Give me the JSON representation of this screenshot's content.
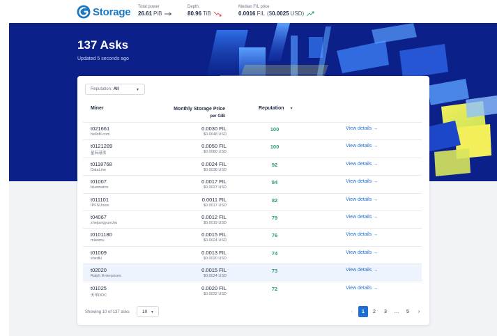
{
  "header": {
    "brand": "Storage",
    "brand_color": "#1a78c2",
    "stats": [
      {
        "label": "Total power",
        "value": "26.61",
        "unit": "PiB",
        "trend": "flat"
      },
      {
        "label": "Depth",
        "value": "80.96",
        "unit": "TiB",
        "trend": "down"
      },
      {
        "label": "Median FIL price",
        "value": "0.0016",
        "unit": "FIL",
        "extra_prefix": "($",
        "extra_value": "0.0025",
        "extra_suffix": "USD)",
        "trend": "up"
      }
    ]
  },
  "hero": {
    "title": "137 Asks",
    "subtitle": "Updated 5 seconds ago",
    "background_color": "#0b2189"
  },
  "filter": {
    "label": "Reputation:",
    "value": "All"
  },
  "table": {
    "columns": {
      "miner": "Miner",
      "price": "Monthly Storage Price",
      "price_sub": "per GiB",
      "reputation": "Reputation"
    },
    "rows": [
      {
        "id": "t021661",
        "name": "hellofil.com",
        "fil": "0.0030 FIL",
        "usd": "$0.0048 USD",
        "rep": "100",
        "link": "View details →"
      },
      {
        "id": "t0121289",
        "name": "星际港湾",
        "fil": "0.0050 FIL",
        "usd": "$0.0080 USD",
        "rep": "100",
        "link": "View details →"
      },
      {
        "id": "t0118768",
        "name": "DataLine",
        "fil": "0.0024 FIL",
        "usd": "$0.0038 USD",
        "rep": "92",
        "link": "View details →"
      },
      {
        "id": "t01007",
        "name": "bluematrix",
        "fil": "0.0017 FIL",
        "usd": "$0.0027 USD",
        "rep": "84",
        "link": "View details →"
      },
      {
        "id": "t011101",
        "name": "IPFSUnion",
        "fil": "0.0011 FIL",
        "usd": "$0.0017 USD",
        "rep": "82",
        "link": "View details →"
      },
      {
        "id": "t04067",
        "name": "zhejiangyunchu",
        "fil": "0.0012 FIL",
        "usd": "$0.0019 USD",
        "rep": "79",
        "link": "View details →"
      },
      {
        "id": "t0101180",
        "name": "mianmu",
        "fil": "0.0015 FIL",
        "usd": "$0.0024 USD",
        "rep": "76",
        "link": "View details →"
      },
      {
        "id": "t01009",
        "name": "shedki",
        "fil": "0.0013 FIL",
        "usd": "$0.0020 USD",
        "rep": "74",
        "link": "View details →"
      },
      {
        "id": "t02020",
        "name": "Ralph Enterprises",
        "fil": "0.0015 FIL",
        "usd": "$0.0024 USD",
        "rep": "73",
        "link": "View details →",
        "highlight": true
      },
      {
        "id": "t01025",
        "name": "天羋DDC",
        "fil": "0.0020 FIL",
        "usd": "$0.0032 USD",
        "rep": "72",
        "link": "View details →"
      }
    ]
  },
  "footer": {
    "showing": "Showing 10 of 137 asks",
    "per_page": "10",
    "pages": [
      "1",
      "2",
      "3",
      "…",
      "5"
    ],
    "current_page": "1"
  },
  "colors": {
    "reputation": "#2a9d6e",
    "link": "#1f6fd1",
    "active_page": "#1f6fd1"
  }
}
